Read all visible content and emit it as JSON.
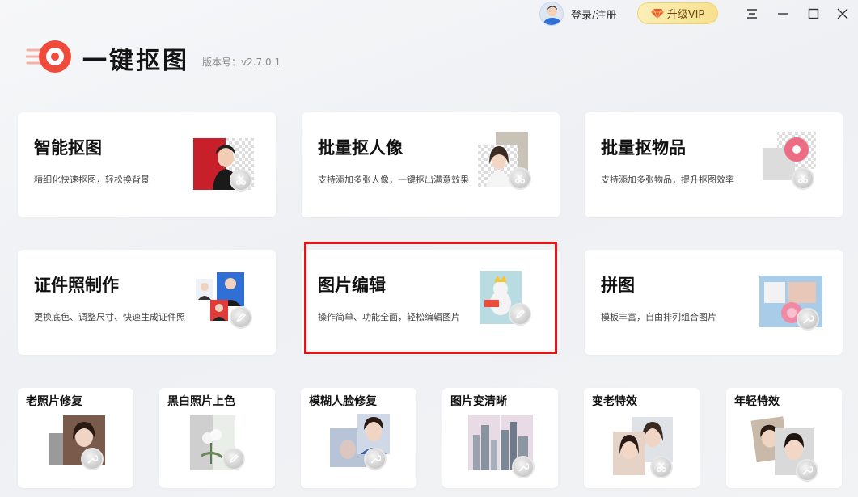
{
  "header": {
    "login_label": "登录/注册",
    "vip_label": "升级VIP"
  },
  "app": {
    "name": "一键抠图",
    "version": "版本号：v2.7.0.1"
  },
  "colors": {
    "brand_red": "#ef4a3a",
    "vip_gold": "#f7e08d",
    "highlight_border": "#e3151b"
  },
  "features": [
    {
      "title": "智能抠图",
      "desc": "精细化快速抠图，轻松换背景",
      "icon": "scissors-icon"
    },
    {
      "title": "批量抠人像",
      "desc": "支持添加多张人像，一键抠出满意效果",
      "icon": "scissors-icon"
    },
    {
      "title": "批量抠物品",
      "desc": "支持添加多张物品，提升抠图效率",
      "icon": "scissors-icon"
    },
    {
      "title": "证件照制作",
      "desc": "更换底色、调整尺寸、快速生成证件照",
      "icon": "pencil-icon"
    },
    {
      "title": "图片编辑",
      "desc": "操作简单、功能全面，轻松编辑图片",
      "icon": "pencil-icon"
    },
    {
      "title": "拼图",
      "desc": "模板丰富，自由排列组合图片",
      "icon": "wrench-icon"
    }
  ],
  "tools": [
    {
      "title": "老照片修复",
      "icon": "wrench-icon"
    },
    {
      "title": "黑白照片上色",
      "icon": "brush-icon"
    },
    {
      "title": "模糊人脸修复",
      "icon": "wrench-icon"
    },
    {
      "title": "图片变清晰",
      "icon": "wrench-icon"
    },
    {
      "title": "变老特效",
      "icon": "scissors-icon"
    },
    {
      "title": "年轻特效",
      "icon": "wrench-icon"
    }
  ]
}
